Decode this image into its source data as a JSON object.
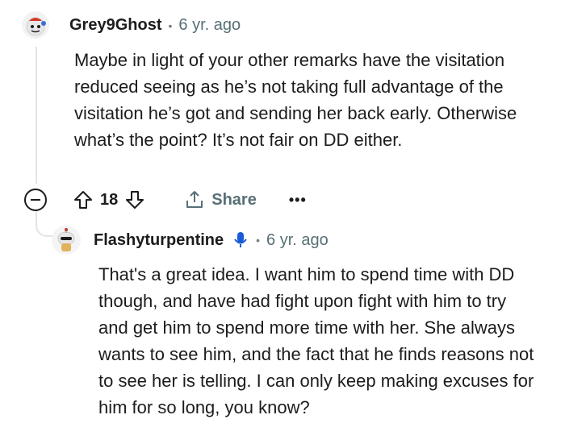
{
  "comments": [
    {
      "username": "Grey9Ghost",
      "separator": "•",
      "time": "6 yr. ago",
      "avatar_icon": "snoo-avatar-icon",
      "body": "Maybe in light of your other remarks have the visitation reduced seeing as he’s not taking full advantage of the visitation he’s got and sending her back early. Otherwise what’s the point? It’s not fair on DD either.",
      "actions": {
        "collapse_icon": "collapse-minus-icon",
        "upvote_icon": "arrow-up-icon",
        "votes": "18",
        "downvote_icon": "arrow-down-icon",
        "share_icon": "share-upload-icon",
        "share_label": "Share",
        "more_label": "•••"
      }
    },
    {
      "username": "Flashyturpentine",
      "badge_icon": "microphone-icon",
      "separator": "•",
      "time": "6 yr. ago",
      "avatar_icon": "snoo-avatar-icon",
      "body": "That's a great idea. I want him to spend time with DD though, and have had fight upon fight with him to try and get him to spend more time with her. She always wants to see him, and the fact that he finds reasons not to see her is telling. I can only keep making excuses for him for so long, you know?"
    }
  ],
  "colors": {
    "text": "#1c1c1c",
    "meta": "#576f76",
    "thread_line": "#e4e4e4",
    "mic_badge": "#1a5bd6"
  }
}
